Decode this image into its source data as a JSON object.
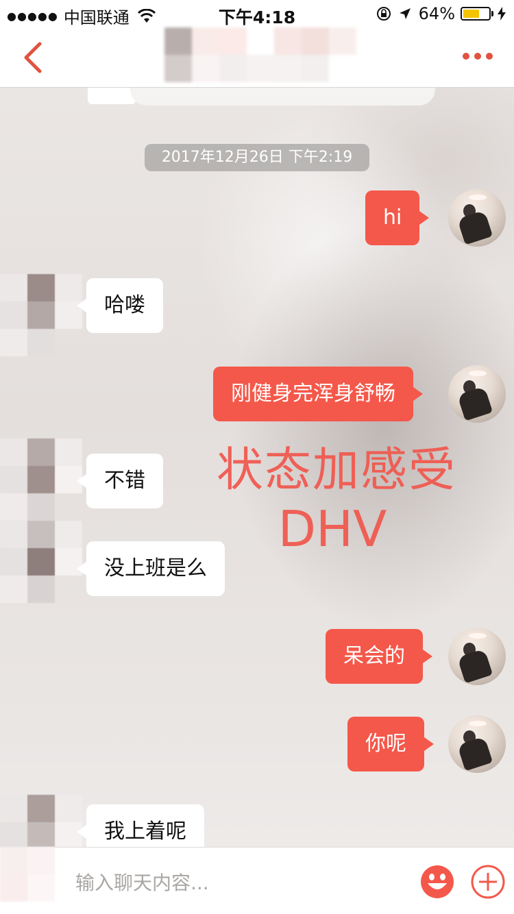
{
  "status_bar": {
    "signal": "●●●●●",
    "carrier": "中国联通",
    "time": "下午4:18",
    "battery": "64%",
    "battery_level": 0.64
  },
  "navbar": {
    "back_icon": "chevron-left-icon",
    "more_icon": "ellipsis-icon",
    "accent": "#e0533f"
  },
  "conversation": {
    "timestamp": "2017年12月26日 下午2:19",
    "messages": [
      {
        "side": "out",
        "text": "hi"
      },
      {
        "side": "in",
        "text": "哈喽"
      },
      {
        "side": "out",
        "text": "刚健身完浑身舒畅"
      },
      {
        "side": "in",
        "text": "不错"
      },
      {
        "side": "in",
        "text": "没上班是么"
      },
      {
        "side": "out",
        "text": "呆会的"
      },
      {
        "side": "out",
        "text": "你呢"
      },
      {
        "side": "in",
        "text": "我上着呢"
      }
    ]
  },
  "annotation": {
    "line1": "状态加感受",
    "line2": "DHV",
    "color": "#f05a50"
  },
  "input_bar": {
    "placeholder": "输入聊天内容...",
    "emoji_icon": "smiley-icon",
    "plus_icon": "plus-circle-icon"
  },
  "colors": {
    "outgoing_bubble": "#f4584a",
    "incoming_bubble": "#ffffff"
  }
}
